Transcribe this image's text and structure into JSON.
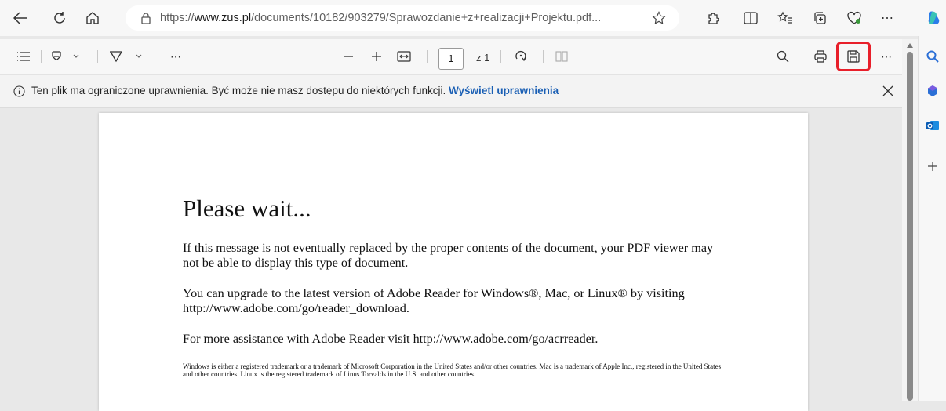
{
  "browser": {
    "url_prefix": "https://",
    "url_domain": "www.zus.pl",
    "url_path": "/documents/10182/903279/Sprawozdanie+z+realizacji+Projektu.pdf..."
  },
  "pdf_toolbar": {
    "current_page": "1",
    "page_total": "z 1"
  },
  "info_bar": {
    "message": "Ten plik ma ograniczone uprawnienia. Być może nie masz dostępu do niektórych funkcji.",
    "link": "Wyświetl uprawnienia"
  },
  "document": {
    "title": "Please wait...",
    "para1": "If this message is not eventually replaced by the proper contents of the document, your PDF viewer may not be able to display this type of document.",
    "para2": "You can upgrade to the latest version of Adobe Reader for Windows®, Mac, or Linux® by visiting  http://www.adobe.com/go/reader_download.",
    "para3": "For more assistance with Adobe Reader visit  http://www.adobe.com/go/acrreader.",
    "small_print": "Windows is either a registered trademark or a trademark of Microsoft Corporation in the United States and/or other countries. Mac is a trademark of Apple Inc., registered in the United States and other countries. Linux is the registered trademark of Linus Torvalds in the U.S. and other countries."
  },
  "colors": {
    "highlight": "#e81f2a",
    "link": "#1a5fb4"
  }
}
